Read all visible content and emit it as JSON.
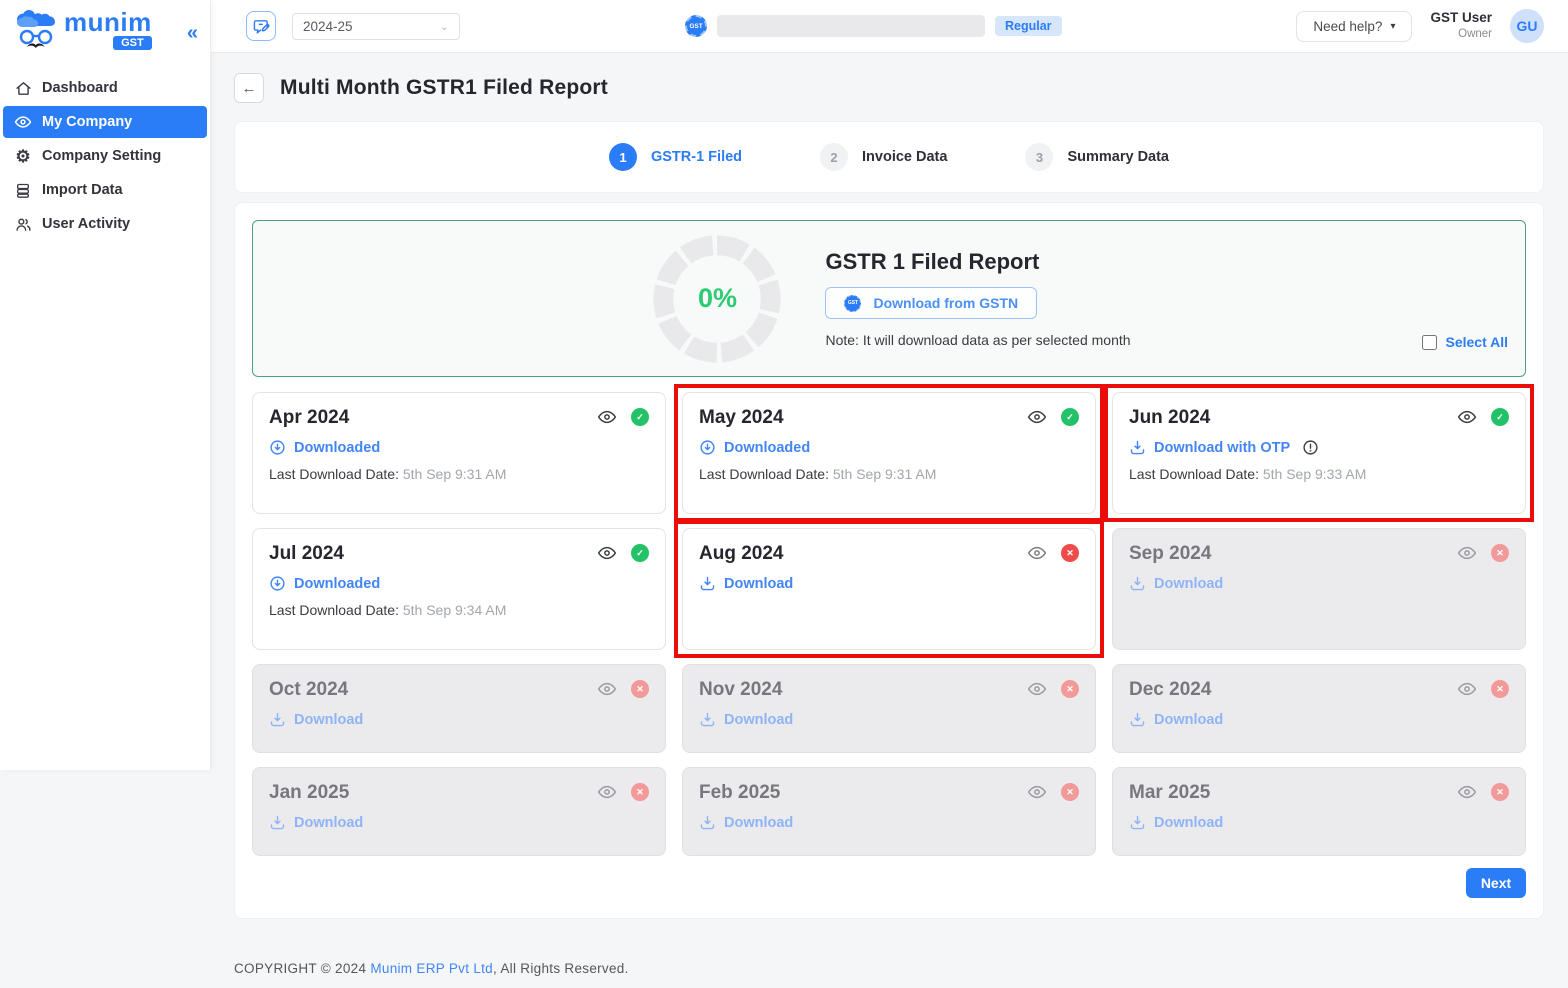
{
  "brand": {
    "name": "munim",
    "sub": "GST"
  },
  "icons": {
    "back": "←",
    "collapse": "«",
    "caret_down": "▾",
    "select_caret": "⌄",
    "check": "✓",
    "cross": "✕"
  },
  "sidebar": {
    "items": [
      {
        "label": "Dashboard"
      },
      {
        "label": "My Company"
      },
      {
        "label": "Company Setting"
      },
      {
        "label": "Import Data"
      },
      {
        "label": "User Activity"
      }
    ]
  },
  "topbar": {
    "fiscal_year": "2024-25",
    "gst_badge": "GST",
    "company_type_badge": "Regular",
    "help_label": "Need help?",
    "user": {
      "name": "GST User",
      "role": "Owner",
      "initials": "GU"
    }
  },
  "page": {
    "title": "Multi Month GSTR1 Filed Report"
  },
  "stepper": {
    "steps": [
      {
        "num": "1",
        "label": "GSTR-1 Filed",
        "active": true
      },
      {
        "num": "2",
        "label": "Invoice Data",
        "active": false
      },
      {
        "num": "3",
        "label": "Summary Data",
        "active": false
      }
    ]
  },
  "report_panel": {
    "progress": "0%",
    "title": "GSTR 1 Filed Report",
    "download_button": "Download from GSTN",
    "note": "Note: It will download data as per selected month",
    "select_all": "Select All"
  },
  "months": [
    {
      "label": "Apr 2024",
      "action": "Downloaded",
      "action_type": "downloaded",
      "date_label": "Last Download Date:",
      "date_value": "5th Sep 9:31 AM",
      "state": "success",
      "disabled": false,
      "annotated": false,
      "alert": false
    },
    {
      "label": "May 2024",
      "action": "Downloaded",
      "action_type": "downloaded",
      "date_label": "Last Download Date:",
      "date_value": "5th Sep 9:31 AM",
      "state": "success",
      "disabled": false,
      "annotated": true,
      "alert": false
    },
    {
      "label": "Jun 2024",
      "action": "Download with OTP",
      "action_type": "download",
      "date_label": "Last Download Date:",
      "date_value": "5th Sep 9:33 AM",
      "state": "success",
      "disabled": false,
      "annotated": true,
      "alert": true
    },
    {
      "label": "Jul 2024",
      "action": "Downloaded",
      "action_type": "downloaded",
      "date_label": "Last Download Date:",
      "date_value": "5th Sep 9:34 AM",
      "state": "success",
      "disabled": false,
      "annotated": false,
      "alert": false
    },
    {
      "label": "Aug 2024",
      "action": "Download",
      "action_type": "download",
      "date_label": "",
      "date_value": "",
      "state": "error",
      "disabled": false,
      "annotated": true,
      "alert": false
    },
    {
      "label": "Sep 2024",
      "action": "Download",
      "action_type": "download",
      "date_label": "",
      "date_value": "",
      "state": "error",
      "disabled": true,
      "annotated": false,
      "alert": false
    },
    {
      "label": "Oct 2024",
      "action": "Download",
      "action_type": "download",
      "date_label": "",
      "date_value": "",
      "state": "error",
      "disabled": true,
      "annotated": false,
      "alert": false
    },
    {
      "label": "Nov 2024",
      "action": "Download",
      "action_type": "download",
      "date_label": "",
      "date_value": "",
      "state": "error",
      "disabled": true,
      "annotated": false,
      "alert": false
    },
    {
      "label": "Dec 2024",
      "action": "Download",
      "action_type": "download",
      "date_label": "",
      "date_value": "",
      "state": "error",
      "disabled": true,
      "annotated": false,
      "alert": false
    },
    {
      "label": "Jan 2025",
      "action": "Download",
      "action_type": "download",
      "date_label": "",
      "date_value": "",
      "state": "error",
      "disabled": true,
      "annotated": false,
      "alert": false
    },
    {
      "label": "Feb 2025",
      "action": "Download",
      "action_type": "download",
      "date_label": "",
      "date_value": "",
      "state": "error",
      "disabled": true,
      "annotated": false,
      "alert": false
    },
    {
      "label": "Mar 2025",
      "action": "Download",
      "action_type": "download",
      "date_label": "",
      "date_value": "",
      "state": "error",
      "disabled": true,
      "annotated": false,
      "alert": false
    }
  ],
  "next_button": "Next",
  "footer": {
    "prefix": "COPYRIGHT © 2024 ",
    "link": "Munim ERP Pvt Ltd",
    "suffix": ", All Rights Reserved."
  },
  "colors": {
    "primary": "#2b7cf7",
    "link": "#4285f4",
    "success": "#23c268",
    "error": "#ee4b4b",
    "annotation": "#ea0d09",
    "panel_border": "#48a37d",
    "progress_text": "#2dcb73"
  }
}
